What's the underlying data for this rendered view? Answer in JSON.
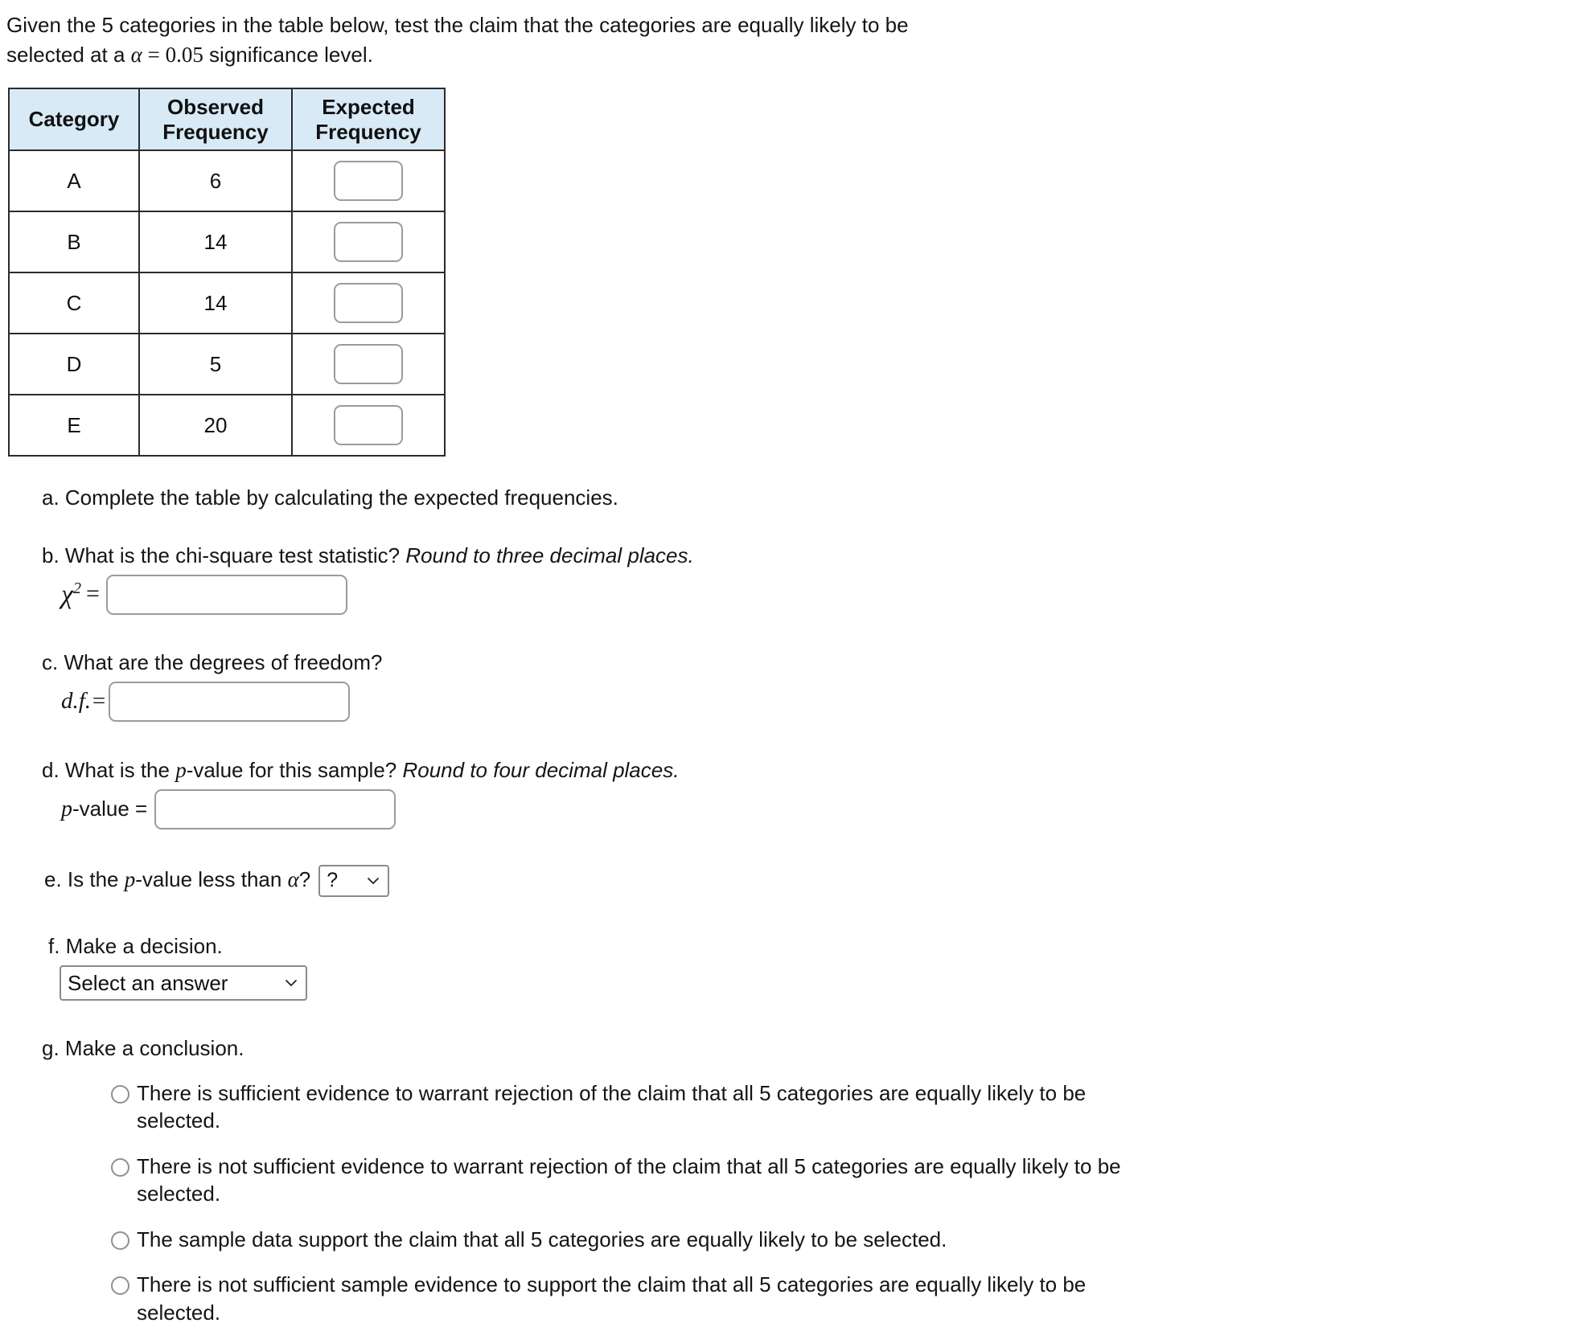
{
  "prompt": {
    "line1": "Given the 5 categories in the table below, test the claim that the categories are equally likely to be",
    "line2_pre": "selected at a ",
    "alpha_symbol": "α",
    "equals": "=",
    "alpha_value": "0.05",
    "line2_post": " significance level."
  },
  "table": {
    "headers": {
      "category": "Category",
      "observed_line1": "Observed",
      "observed_line2": "Frequency",
      "expected_line1": "Expected",
      "expected_line2": "Frequency"
    },
    "header_bg": "#d9eaf7",
    "border_color": "#2b2b2b",
    "rows": [
      {
        "category": "A",
        "observed": "6",
        "expected": ""
      },
      {
        "category": "B",
        "observed": "14",
        "expected": ""
      },
      {
        "category": "C",
        "observed": "14",
        "expected": ""
      },
      {
        "category": "D",
        "observed": "5",
        "expected": ""
      },
      {
        "category": "E",
        "observed": "20",
        "expected": ""
      }
    ]
  },
  "questions": {
    "a": {
      "text": "a. Complete the table by calculating the expected frequencies."
    },
    "b": {
      "label": "b. What is the chi-square test statistic?",
      "italic_note": "Round to three decimal places.",
      "chi_symbol": "χ",
      "chi_exponent": "2",
      "equals": "=",
      "value": "",
      "placeholder": ""
    },
    "c": {
      "label": "c. What are the degrees of freedom?",
      "df_label": "d.f.=",
      "value": "",
      "placeholder": ""
    },
    "d": {
      "label_pre": "d. What is the ",
      "label_p": "p",
      "label_post": "-value for this sample?",
      "italic_note": "Round to four decimal places.",
      "pvalue_label_p": "p",
      "pvalue_label_rest": "-value =",
      "value": "",
      "placeholder": ""
    },
    "e": {
      "label_pre": "e. Is the ",
      "label_p": "p",
      "label_mid": "-value less than ",
      "alpha_symbol": "α",
      "label_post": "?",
      "select_value": "?"
    },
    "f": {
      "label": "f. Make a decision.",
      "select_value": "Select an answer"
    },
    "g": {
      "label": "g. Make a conclusion.",
      "options": [
        "There is sufficient evidence to warrant rejection of the claim that all 5 categories are equally likely to be selected.",
        "There is not sufficient evidence to warrant rejection of the claim that all 5 categories are equally likely to be selected.",
        "The sample data support the claim that all 5 categories are equally likely to be selected.",
        "There is not sufficient sample evidence to support the claim that all 5 categories are equally likely to be selected."
      ]
    }
  },
  "icons": {
    "chevron_down": "chevron-down-icon",
    "radio": "radio-button-icon"
  }
}
